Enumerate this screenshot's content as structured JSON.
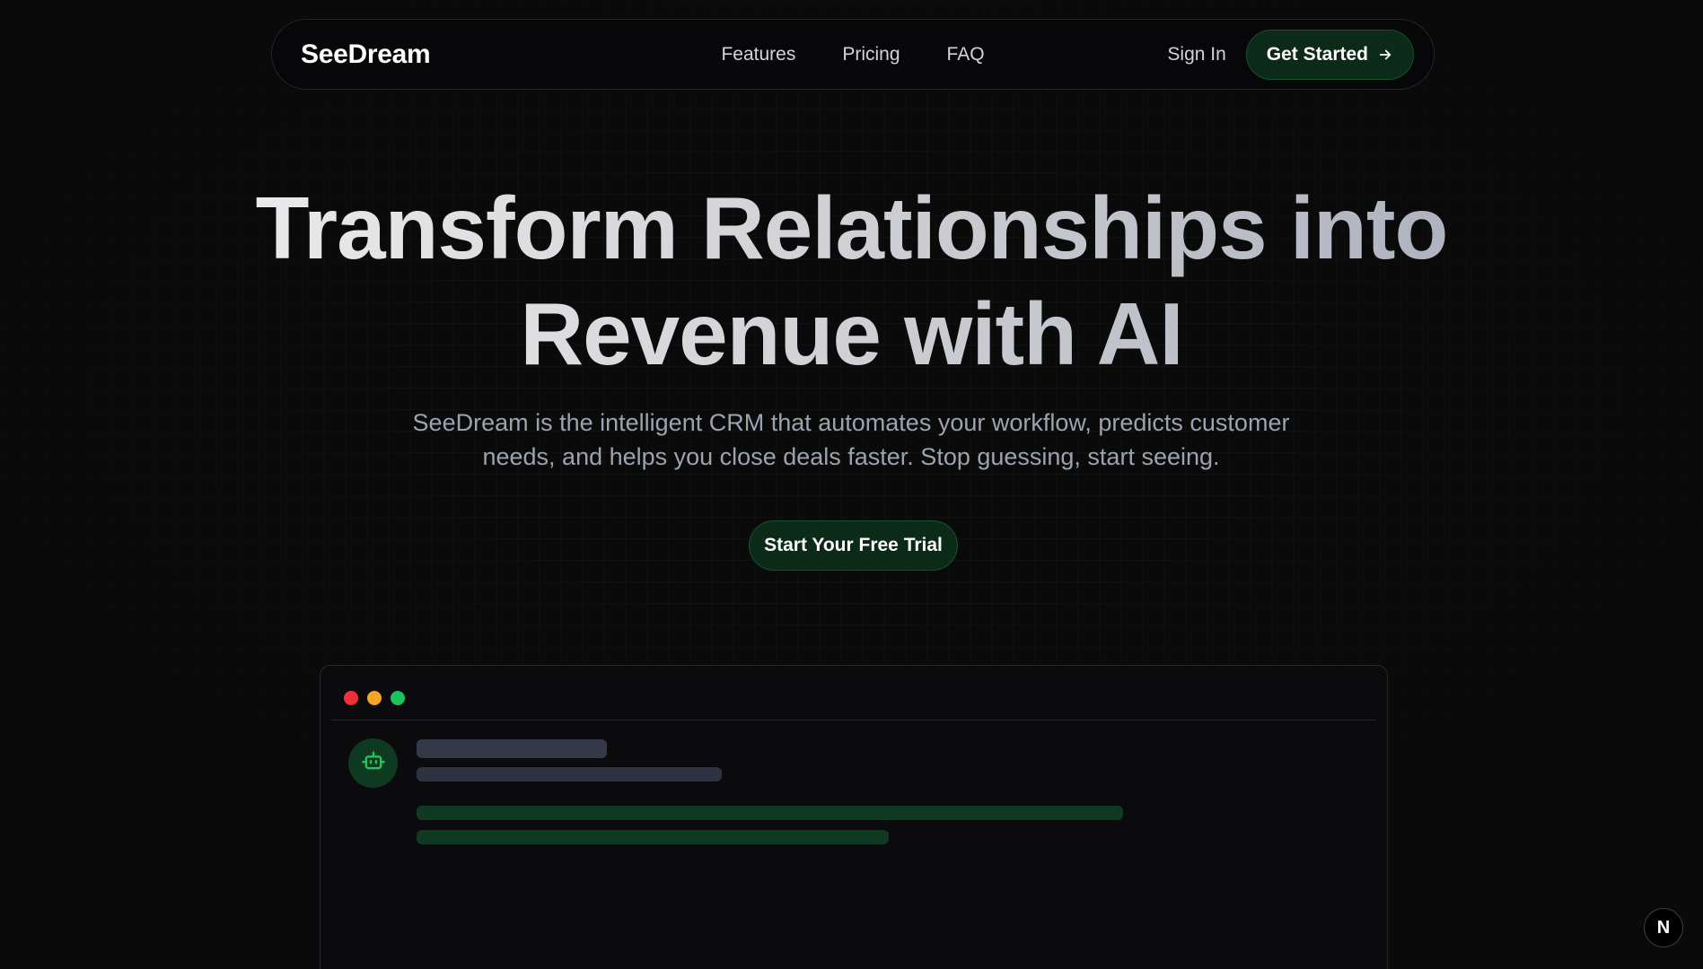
{
  "nav": {
    "brand": "SeeDream",
    "links": [
      {
        "label": "Features"
      },
      {
        "label": "Pricing"
      },
      {
        "label": "FAQ"
      }
    ],
    "sign_in": "Sign In",
    "get_started": "Get Started",
    "get_started_icon": "arrow-right-icon"
  },
  "hero": {
    "title_line1": "Transform Relationships into",
    "title_line2": "Revenue with AI",
    "subtitle_line1": "SeeDream is the intelligent CRM that automates your workflow, predicts customer",
    "subtitle_line2": "needs, and helps you close deals faster. Stop guessing, start seeing.",
    "cta": "Start Your Free Trial"
  },
  "preview_window": {
    "window_controls": [
      "close",
      "minimize",
      "maximize"
    ],
    "avatar_icon": "robot-icon"
  },
  "badge": {
    "label": "N"
  },
  "colors": {
    "background": "#0a0a0b",
    "accent_green": "#0b2a18",
    "accent_green_border": "#14532d",
    "icon_green": "#22c55e",
    "dot_red": "#ef2f3a",
    "dot_yellow": "#f5a524",
    "dot_green": "#18c45b"
  }
}
